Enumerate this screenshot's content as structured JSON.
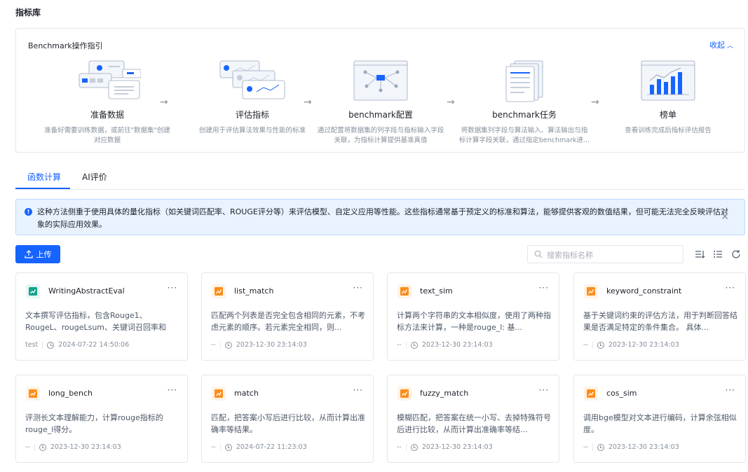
{
  "page": {
    "title": "指标库"
  },
  "guide": {
    "title": "Benchmark操作指引",
    "collapse_label": "收起",
    "steps": [
      {
        "title": "准备数据",
        "desc": "准备好需要训练数据，或前往\"数据集\"创建对应数据"
      },
      {
        "title": "评估指标",
        "desc": "创建用于评估算法效果与性能的标准"
      },
      {
        "title": "benchmark配置",
        "desc": "通过配置将数据集的列字段与指标输入字段关联，为指标计算提供基准真值"
      },
      {
        "title": "benchmark任务",
        "desc": "将数据集列字段与算法输入、算法输出与指标计算字段关联，通过指定benchmark进..."
      },
      {
        "title": "榜单",
        "desc": "查看训练完成后指标评估报告"
      }
    ]
  },
  "tabs": [
    {
      "label": "函数计算"
    },
    {
      "label": "AI评价"
    }
  ],
  "banner": {
    "text": "这种方法侧重于使用具体的量化指标（如关键词匹配率、ROUGE评分等）来评估模型、自定义应用等性能。这些指标通常基于预定义的标准和算法，能够提供客观的数值结果，但可能无法完全反映评估对象的实际应用效果。"
  },
  "toolbar": {
    "upload_label": "上传",
    "search_placeholder": "搜索指标名称"
  },
  "cards": [
    {
      "name": "WritingAbstractEval",
      "desc": "文本撰写评估指标，包含Rouge1、RougeL、rougeLsum、关键词召回率和平...",
      "user": "test",
      "time": "2024-07-22 14:50:06",
      "icon_color": "#14a38b"
    },
    {
      "name": "list_match",
      "desc": "匹配两个列表是否完全包含相同的元素，不考虑元素的顺序。若元素完全相同，则...",
      "user": "--",
      "time": "2023-12-30 23:14:03",
      "icon_color": "#ff8d1a"
    },
    {
      "name": "text_sim",
      "desc": "计算两个字符串的文本相似度，使用了两种指标方法来计算，一种是rouge_l: 基...",
      "user": "--",
      "time": "2023-12-30 23:14:03",
      "icon_color": "#ff8d1a"
    },
    {
      "name": "keyword_constraint",
      "desc": "基于关键词约束的评估方法，用于判断回答结果是否满足特定的条件集合。 具体...",
      "user": "--",
      "time": "2023-12-30 23:14:03",
      "icon_color": "#ff8d1a"
    },
    {
      "name": "long_bench",
      "desc": "评测长文本理解能力，计算rouge指标的rouge_l得分。",
      "user": "--",
      "time": "2023-12-30 23:14:03",
      "icon_color": "#ff8d1a"
    },
    {
      "name": "match",
      "desc": "匹配，把答案小写后进行比较，从而计算出准确率等结果。",
      "user": "--",
      "time": "2024-07-22 11:23:03",
      "icon_color": "#ff8d1a"
    },
    {
      "name": "fuzzy_match",
      "desc": "模糊匹配，把答案在统一小写、去掉特殊符号后进行比较，从而计算出准确率等结...",
      "user": "--",
      "time": "2023-12-30 23:14:03",
      "icon_color": "#ff8d1a"
    },
    {
      "name": "cos_sim",
      "desc": "调用bge模型对文本进行编码，计算余弦相似度。",
      "user": "--",
      "time": "2023-12-30 23:14:03",
      "icon_color": "#ff8d1a"
    }
  ]
}
